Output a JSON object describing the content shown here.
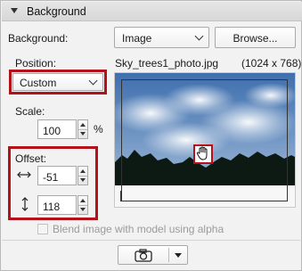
{
  "section": {
    "title": "Background"
  },
  "background": {
    "label": "Background:",
    "select_value": "Image",
    "browse_label": "Browse..."
  },
  "position": {
    "label": "Position:",
    "select_value": "Custom"
  },
  "image": {
    "filename": "Sky_trees1_photo.jpg",
    "dimensions": "(1024 x 768)"
  },
  "scale": {
    "label": "Scale:",
    "value": "100",
    "unit": "%"
  },
  "offset": {
    "label": "Offset:",
    "x_value": "-51",
    "y_value": "118"
  },
  "blend": {
    "label": "Blend image with model using alpha",
    "checked": false
  },
  "colors": {
    "highlight": "#b3121a",
    "sky": "#4a79b4",
    "treeline": "#0d1a14"
  },
  "icons": [
    "disclosure-triangle-icon",
    "chevron-down-icon",
    "horizontal-arrows-icon",
    "vertical-arrows-icon",
    "hand-cursor-icon",
    "camera-icon"
  ]
}
